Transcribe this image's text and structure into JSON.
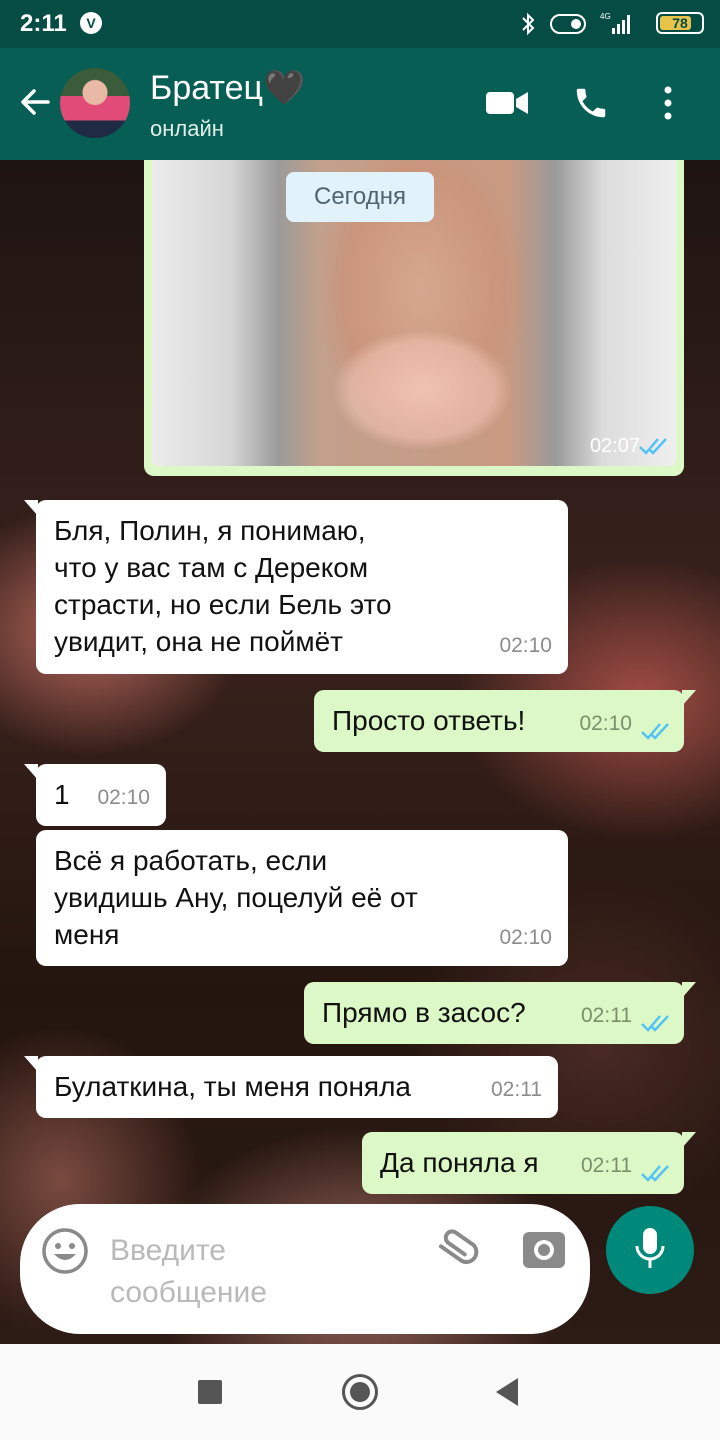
{
  "status_bar": {
    "time": "2:11",
    "carrier_badge": "V",
    "network": "4G",
    "battery": "78",
    "battery_level": 0.78
  },
  "header": {
    "contact_name": "Братец🖤",
    "status": "онлайн",
    "icons": [
      "back-arrow-icon",
      "video-call-icon",
      "phone-icon",
      "more-vert-icon"
    ]
  },
  "chat": {
    "image_message": {
      "time": "02:07"
    },
    "date_chip": "Сегодня",
    "messages": [
      {
        "dir": "in",
        "lines": [
          "Бля, Полин, я понимаю,",
          "что у вас там с Дереком",
          "страсти, но если Бель это",
          "увидит, она не поймёт"
        ],
        "time": "02:10"
      },
      {
        "dir": "out",
        "lines": [
          "Просто ответь!"
        ],
        "time": "02:10"
      },
      {
        "dir": "in",
        "lines": [
          "1"
        ],
        "time": "02:10"
      },
      {
        "dir": "in",
        "lines": [
          "Всё я работать, если",
          "увидишь Ану, поцелуй её от",
          "меня"
        ],
        "time": "02:10"
      },
      {
        "dir": "out",
        "lines": [
          "Прямо в засос?"
        ],
        "time": "02:11"
      },
      {
        "dir": "in",
        "lines": [
          "Булаткина, ты меня поняла"
        ],
        "time": "02:11"
      },
      {
        "dir": "out",
        "lines": [
          "Да поняла я"
        ],
        "time": "02:11"
      }
    ]
  },
  "input": {
    "placeholder_lines": [
      "Введите",
      "сообщение"
    ]
  },
  "colors": {
    "header": "#075e54",
    "status_bar": "#054d44",
    "outgoing": "#dcf8c6",
    "incoming": "#ffffff",
    "accent": "#00897b",
    "read_ticks": "#4fc3f7"
  }
}
